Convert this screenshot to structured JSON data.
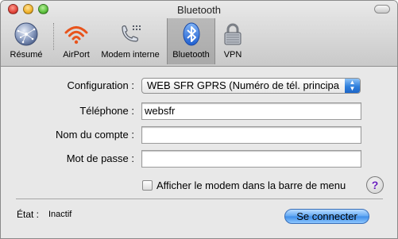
{
  "window": {
    "title": "Bluetooth"
  },
  "toolbar": {
    "items": [
      {
        "label": "Résumé",
        "icon": "network-globe-icon",
        "selected": false
      },
      {
        "label": "AirPort",
        "icon": "airport-wifi-icon",
        "selected": false
      },
      {
        "label": "Modem interne",
        "icon": "modem-phone-icon",
        "selected": false
      },
      {
        "label": "Bluetooth",
        "icon": "bluetooth-icon",
        "selected": true
      },
      {
        "label": "VPN",
        "icon": "vpn-lock-icon",
        "selected": false
      }
    ]
  },
  "form": {
    "configuration_label": "Configuration :",
    "configuration_value": "WEB SFR GPRS (Numéro de tél. principa",
    "telephone_label": "Téléphone :",
    "telephone_value": "websfr",
    "account_label": "Nom du compte :",
    "account_value": "",
    "password_label": "Mot de passe :",
    "password_value": ""
  },
  "options": {
    "show_modem_label": "Afficher le modem dans la barre de menu",
    "show_modem_checked": false
  },
  "help": {
    "label": "?"
  },
  "status": {
    "label": "État :",
    "value": "Inactif"
  },
  "actions": {
    "connect_label": "Se connecter"
  },
  "colors": {
    "accent": "#3d8de8",
    "airport": "#e8541c",
    "bluetooth": "#1f5fd0",
    "help": "#6a1fbf"
  }
}
